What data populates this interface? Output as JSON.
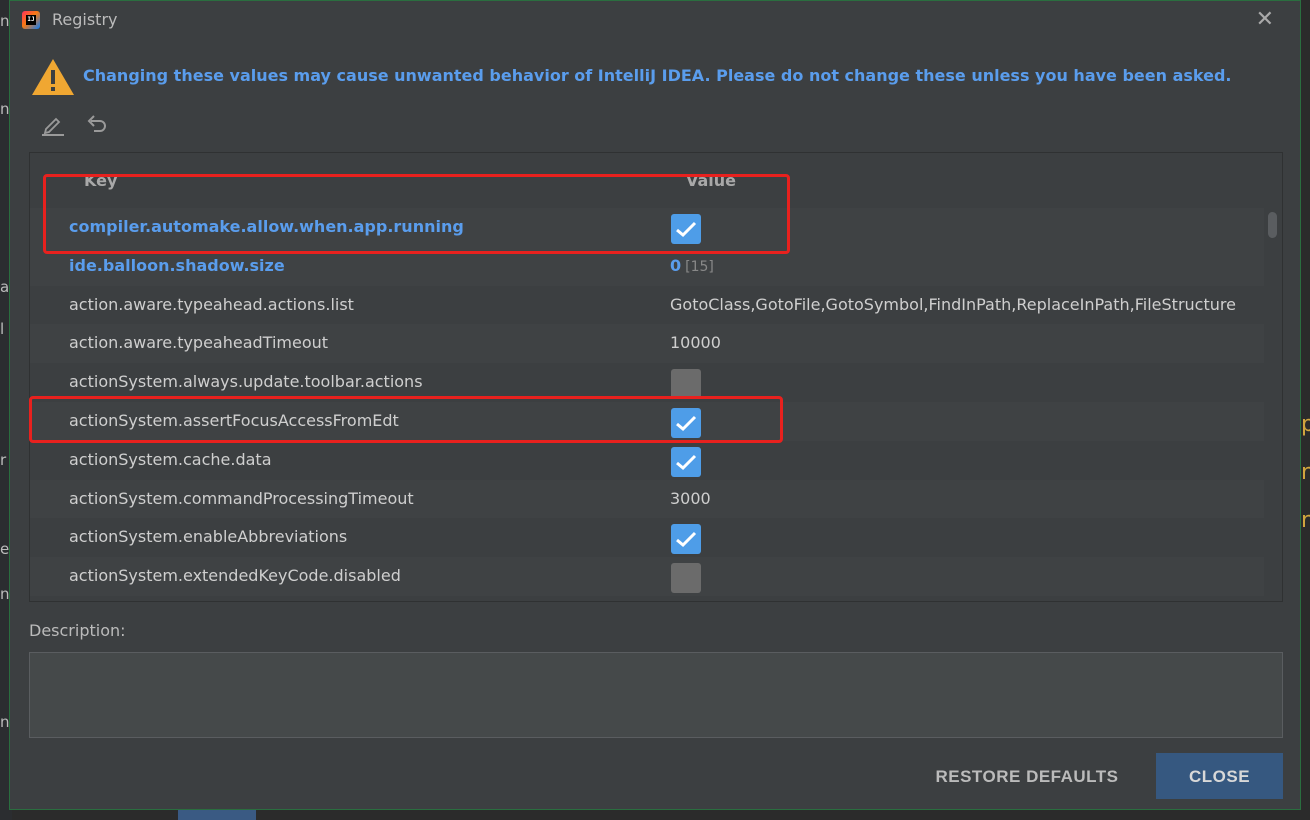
{
  "dialog": {
    "title": "Registry",
    "close_glyph": "✕",
    "warning": "Changing these values may cause unwanted behavior of IntelliJ IDEA. Please do not change these unless you have been asked."
  },
  "toolbar": {
    "edit_icon": "edit-icon",
    "revert_icon": "revert-icon"
  },
  "table": {
    "headers": {
      "key": "Key",
      "value": "Value"
    },
    "rows": [
      {
        "key": "compiler.automake.allow.when.app.running",
        "type": "bool",
        "checked": true,
        "modified": true
      },
      {
        "key": "ide.balloon.shadow.size",
        "type": "num",
        "value": "0",
        "default": "[15]",
        "modified": true
      },
      {
        "key": "action.aware.typeahead.actions.list",
        "type": "text",
        "value": "GotoClass,GotoFile,GotoSymbol,FindInPath,ReplaceInPath,FileStructure",
        "modified": false
      },
      {
        "key": "action.aware.typeaheadTimeout",
        "type": "text",
        "value": "10000",
        "modified": false
      },
      {
        "key": "actionSystem.always.update.toolbar.actions",
        "type": "bool",
        "checked": false,
        "modified": false
      },
      {
        "key": "actionSystem.assertFocusAccessFromEdt",
        "type": "bool",
        "checked": true,
        "modified": false
      },
      {
        "key": "actionSystem.cache.data",
        "type": "bool",
        "checked": true,
        "modified": false
      },
      {
        "key": "actionSystem.commandProcessingTimeout",
        "type": "text",
        "value": "3000",
        "modified": false
      },
      {
        "key": "actionSystem.enableAbbreviations",
        "type": "bool",
        "checked": true,
        "modified": false
      },
      {
        "key": "actionSystem.extendedKeyCode.disabled",
        "type": "bool",
        "checked": false,
        "modified": false
      }
    ]
  },
  "description": {
    "label": "Description:",
    "text": ""
  },
  "buttons": {
    "restore": "RESTORE DEFAULTS",
    "close": "CLOSE"
  },
  "colors": {
    "accent": "#5a9ded",
    "checkbox_on": "#4e9de8",
    "highlight": "#e8211e",
    "close_button": "#365880"
  }
}
